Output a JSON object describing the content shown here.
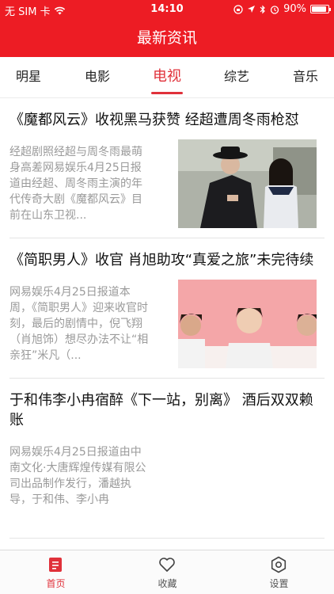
{
  "status_bar": {
    "carrier": "无 SIM 卡",
    "time": "14:10",
    "battery_percent": "90%",
    "battery_level": 0.9
  },
  "navbar": {
    "title": "最新资讯"
  },
  "tabs": [
    {
      "label": "明星",
      "active": false
    },
    {
      "label": "电影",
      "active": false
    },
    {
      "label": "电视",
      "active": true
    },
    {
      "label": "综艺",
      "active": false
    },
    {
      "label": "音乐",
      "active": false
    }
  ],
  "articles": [
    {
      "title": "《魔都风云》收视黑马获赞 经超遭周冬雨枪怼",
      "summary": "经超剧照经超与周冬雨最萌身高差网易娱乐4月25日报道由经超、周冬雨主演的年代传奇大剧《魔都风云》目前在山东卫视..."
    },
    {
      "title": "《简职男人》收官 肖旭助攻“真爱之旅”未完待续",
      "summary": "网易娱乐4月25日报道本周，《简职男人》迎来收官时刻，最后的剧情中，倪飞翔（肖旭饰）想尽办法不让“相亲狂”米凡（..."
    },
    {
      "title": "于和伟李小冉宿醉《下一站，别离》 酒后双双赖账",
      "summary": "网易娱乐4月25日报道由中南文化·大唐辉煌传媒有限公司出品制作发行，潘越执导，于和伟、李小冉"
    }
  ],
  "tabbar": [
    {
      "label": "首页",
      "icon": "home-icon",
      "active": true
    },
    {
      "label": "收藏",
      "icon": "heart-icon",
      "active": false
    },
    {
      "label": "设置",
      "icon": "settings-icon",
      "active": false
    }
  ],
  "colors": {
    "brand": "#ed1c24",
    "accent": "#e0313a",
    "summary_text": "#9a9a9a"
  }
}
